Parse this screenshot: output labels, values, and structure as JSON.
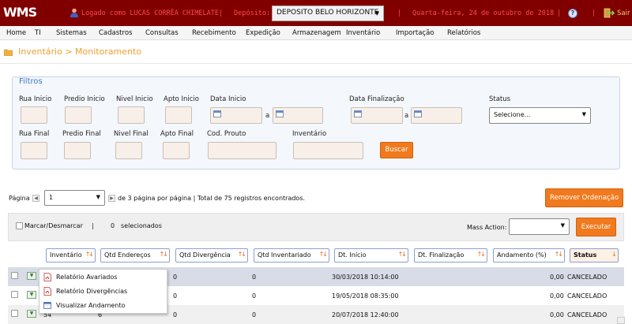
{
  "app": {
    "logo": "WMS",
    "user_status": "Logado como LUCAS CORRÊA CHIMELATE",
    "sep1": "|",
    "depot_label": "Depósito:",
    "depot_value": "DEPOSITO BELO HORIZONTE",
    "sep2": "|",
    "date": "Quarta-feira, 24 de outubro de 2018",
    "sep3": "|",
    "sep4": "|",
    "help_glyph": "?",
    "exit_label": "Sair",
    "icons": {
      "user": "user-icon",
      "help": "help-icon",
      "exit": "exit-icon"
    },
    "colors": {
      "topbar": "#800000",
      "topbar_text": "#ff4a4a",
      "accent": "#f07a1d",
      "breadcrumb": "#f0a030",
      "filters_title": "#3d7bbf"
    }
  },
  "menu": [
    "Home",
    "TI",
    "Sistemas",
    "Cadastros",
    "Consultas",
    "Recebimento",
    "Expedição",
    "Armazenagem",
    "Inventário",
    "Importação",
    "Relatórios"
  ],
  "breadcrumb": "Inventário > Monitoramento",
  "filters": {
    "title": "Filtros",
    "rua_inicio": "Rua Inicio",
    "predio_inicio": "Predio Inicio",
    "nivel_inicio": "Nivel Inicio",
    "apto_inicio": "Apto Inicio",
    "data_inicio": "Data Inicio",
    "a_1": "a",
    "data_finalizacao": "Data Finalização",
    "a_2": "a",
    "status": "Status",
    "status_value": "Selecione...",
    "rua_final": "Rua Final",
    "predio_final": "Predio Final",
    "nivel_final": "Nivel Final",
    "apto_final": "Apto Final",
    "cod_produto": "Cod. Prouto",
    "inventario": "Inventário",
    "search_button": "Buscar"
  },
  "pagination": {
    "page_label": "Página",
    "page_value": "1",
    "info": "de 3 página por página | Total de 75 registros encontrados.",
    "remove_sort_button": "Remover Ordenação"
  },
  "mass": {
    "select_all": "Marcar/Desmarcar",
    "sep": "|",
    "selected_count": "0",
    "selected_label": "selecionados",
    "action_label": "Mass Action:",
    "action_value": "",
    "execute_button": "Executar"
  },
  "table": {
    "columns": [
      "Inventário",
      "Qtd Endereços",
      "Qtd Divergência",
      "Qtd Inventariado",
      "Dt. Início",
      "Dt. Finalização",
      "Andamento (%)",
      "Status"
    ],
    "sort_glyph": "↑↓",
    "status_sort_glyph": "↓",
    "action_glyph": "▼",
    "rows": [
      {
        "inventario": "",
        "enderecos": "",
        "divergencia": "0",
        "inventariado": "0",
        "inicio": "30/03/2018 10:14:00",
        "finalizacao": "",
        "andamento": "0,00",
        "status": "CANCELADO"
      },
      {
        "inventario": "",
        "enderecos": "",
        "divergencia": "0",
        "inventariado": "0",
        "inicio": "19/05/2018 08:35:00",
        "finalizacao": "",
        "andamento": "0,00",
        "status": "CANCELADO"
      },
      {
        "inventario": "54",
        "enderecos": "6",
        "divergencia": "0",
        "inventariado": "0",
        "inicio": "20/07/2018 12:40:00",
        "finalizacao": "",
        "andamento": "0,00",
        "status": "CANCELADO"
      }
    ]
  },
  "context_menu": {
    "items": [
      {
        "label": "Relatório Avariados",
        "icon": "pdf-icon"
      },
      {
        "label": "Relatório Divergências",
        "icon": "pdf-icon"
      },
      {
        "label": "Visualizar Andamento",
        "icon": "window-icon"
      }
    ]
  }
}
